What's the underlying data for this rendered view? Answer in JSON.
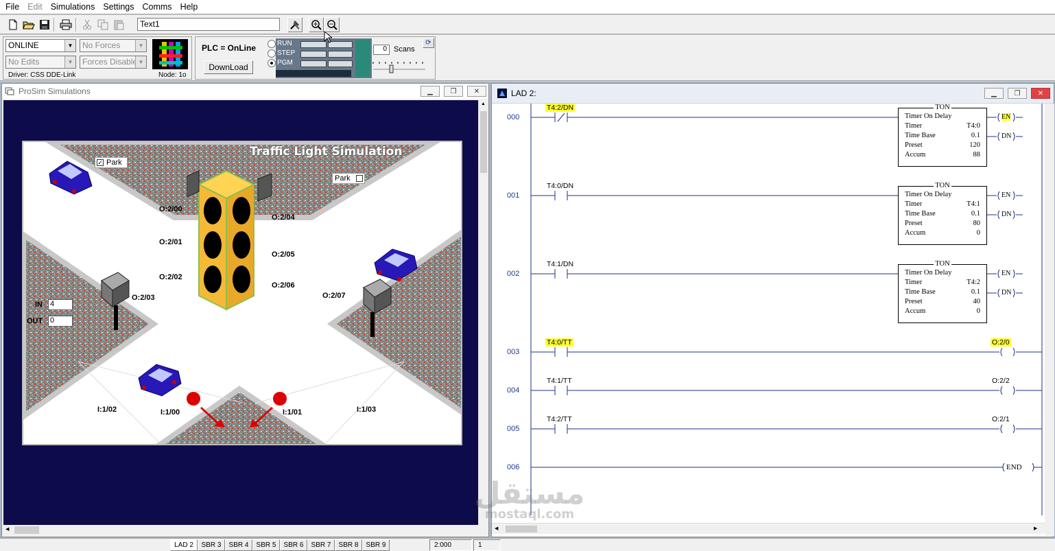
{
  "menu": [
    "File",
    "Edit",
    "Simulations",
    "Settings",
    "Comms",
    "Help"
  ],
  "toolbar": {
    "text_field": "Text1"
  },
  "status_controls": {
    "mode": "ONLINE",
    "forces": "No Forces",
    "edits": "No Edits",
    "forces_enabled": "Forces Disabled",
    "driver": "Driver:  CSS DDE-Link",
    "node": "Node: 1o"
  },
  "plc": {
    "status": "PLC = OnLine",
    "download_label": "DownLoad",
    "modes": [
      "RUN",
      "STEP",
      "PGM"
    ],
    "selected_mode": "PGM",
    "scans_value": "0",
    "scans_label": "Scans"
  },
  "left_window": {
    "title": "ProSim Simulations",
    "scene_title": "Traffic Light Simulation",
    "park_left": "Park",
    "park_right": "Park",
    "park_left_checked": true,
    "park_right_checked": false,
    "in_label": "IN",
    "in_value": "4",
    "out_label": "OUT",
    "out_value": "0",
    "outputs": [
      "O:2/00",
      "O:2/01",
      "O:2/02",
      "O:2/03",
      "O:2/04",
      "O:2/05",
      "O:2/06",
      "O:2/07"
    ],
    "inputs": [
      "I:1/00",
      "I:1/01",
      "I:1/02",
      "I:1/03"
    ]
  },
  "right_window": {
    "title": "LAD 2:",
    "rungs": [
      {
        "num": "000",
        "contact": "T4:2/DN",
        "contact_type": "NC",
        "highlight": true,
        "ton": {
          "title": "TON",
          "name": "Timer On Delay",
          "timer": "T4:0",
          "time_base": "0.1",
          "preset": "120",
          "accum": "88"
        },
        "en": "EN",
        "dn": "DN",
        "en_highlight": true
      },
      {
        "num": "001",
        "contact": "T4:0/DN",
        "contact_type": "NO",
        "highlight": false,
        "ton": {
          "title": "TON",
          "name": "Timer On Delay",
          "timer": "T4:1",
          "time_base": "0.1",
          "preset": "80",
          "accum": "0"
        },
        "en": "EN",
        "dn": "DN",
        "en_highlight": false
      },
      {
        "num": "002",
        "contact": "T4:1/DN",
        "contact_type": "NO",
        "highlight": false,
        "ton": {
          "title": "TON",
          "name": "Timer On Delay",
          "timer": "T4:2",
          "time_base": "0.1",
          "preset": "40",
          "accum": "0"
        },
        "en": "EN",
        "dn": "DN",
        "en_highlight": false
      },
      {
        "num": "003",
        "contact": "T4:0/TT",
        "contact_type": "NO",
        "highlight": true,
        "coil": "O:2/0",
        "coil_highlight": true
      },
      {
        "num": "004",
        "contact": "T4:1/TT",
        "contact_type": "NO",
        "highlight": false,
        "coil": "O:2/2",
        "coil_highlight": false
      },
      {
        "num": "005",
        "contact": "T4:2/TT",
        "contact_type": "NO",
        "highlight": false,
        "coil": "O:2/1",
        "coil_highlight": false
      },
      {
        "num": "006",
        "end": "END"
      }
    ],
    "ton_labels": {
      "timer": "Timer",
      "time_base": "Time Base",
      "preset": "Preset",
      "accum": "Accum"
    }
  },
  "statusbar": {
    "tabs": [
      "LAD 2",
      "SBR 3",
      "SBR 4",
      "SBR 5",
      "SBR 6",
      "SBR 7",
      "SBR 8",
      "SBR 9"
    ],
    "address": "2:000",
    "count": "1"
  },
  "watermark": {
    "main": "مستقل",
    "sub": "mostaql.com"
  }
}
